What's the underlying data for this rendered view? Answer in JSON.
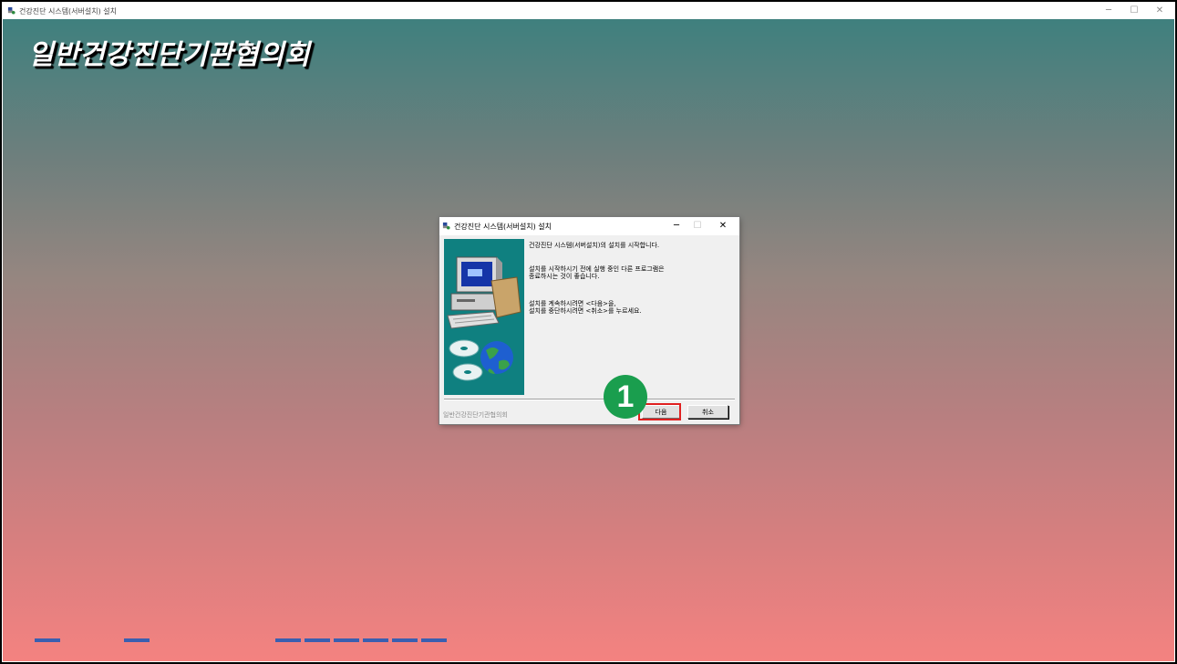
{
  "window": {
    "title": "건강진단 시스템(서버설치) 설치",
    "controls": {
      "minimize": "─",
      "maximize": "☐",
      "close": "✕"
    }
  },
  "app": {
    "org_title": "일반건강진단기관협의회"
  },
  "dialog": {
    "title": "건강진단 시스템(서버설치) 설치",
    "controls": {
      "minimize": "─",
      "maximize": "☐",
      "close": "✕"
    },
    "text_line1": "건강진단 시스템(서버설치)의 설치를 시작합니다.",
    "text_line2": "설치를 시작하시기 전에 실행 중인 다른 프로그램은",
    "text_line3": "종료하시는 것이 좋습니다.",
    "text_line4": "설치를 계속하시려면 <다음>을,",
    "text_line5": "설치를 중단하시려면 <취소>를 누르세요.",
    "footer": "일반건강진단기관협의회",
    "next_label": "다음",
    "cancel_label": "취소"
  },
  "annotation": {
    "step_number": "1",
    "highlight_color": "#e02020",
    "badge_color": "#1a9e4e"
  },
  "colors": {
    "gradient_top": "#3f807e",
    "gradient_bottom": "#f48280",
    "dialog_image_bg": "#0f8080"
  },
  "icons": {
    "app_icon": "installer-icon",
    "dialog_art": "computer-globe-cd-illustration"
  }
}
